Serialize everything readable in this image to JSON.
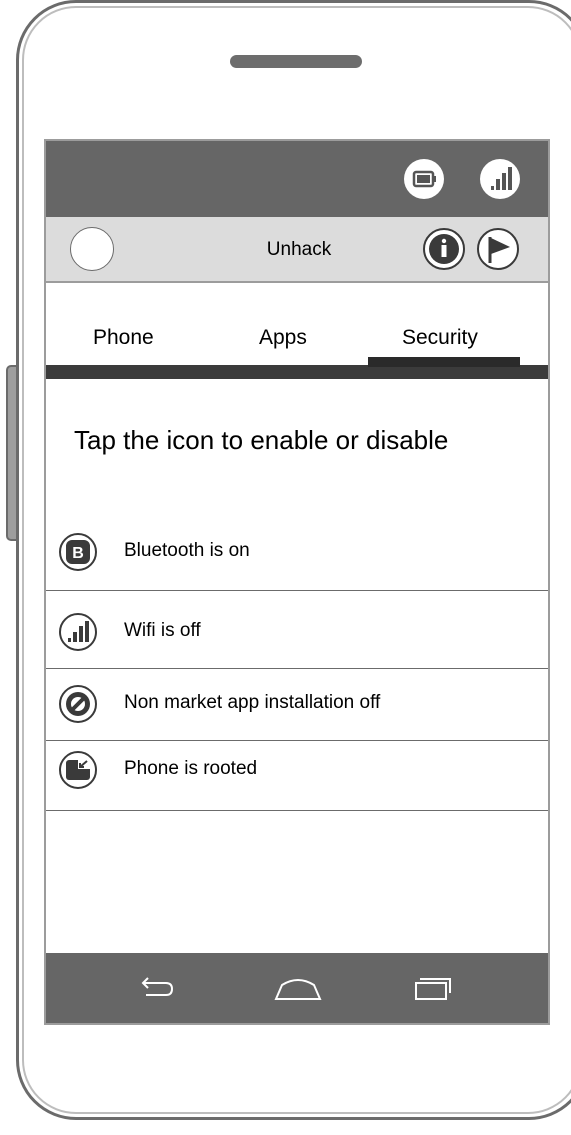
{
  "app": {
    "title": "Unhack"
  },
  "tabs": [
    {
      "label": "Phone"
    },
    {
      "label": "Apps"
    },
    {
      "label": "Security",
      "active": true
    }
  ],
  "headline": "Tap the icon to enable or disable",
  "items": [
    {
      "label": "Bluetooth is on",
      "icon": "bluetooth-icon"
    },
    {
      "label": "Wifi is off",
      "icon": "signal-icon"
    },
    {
      "label": "Non market app installation off",
      "icon": "block-icon"
    },
    {
      "label": "Phone is rooted",
      "icon": "window-exit-icon"
    }
  ],
  "status_icons": [
    "battery-icon",
    "signal-icon"
  ],
  "app_actions": [
    "info-icon",
    "flag-icon"
  ],
  "nav": [
    "back-icon",
    "home-icon",
    "recents-icon"
  ],
  "colors": {
    "statusbar": "#666666",
    "appbar": "#dcdcdc",
    "navbar": "#666666"
  }
}
